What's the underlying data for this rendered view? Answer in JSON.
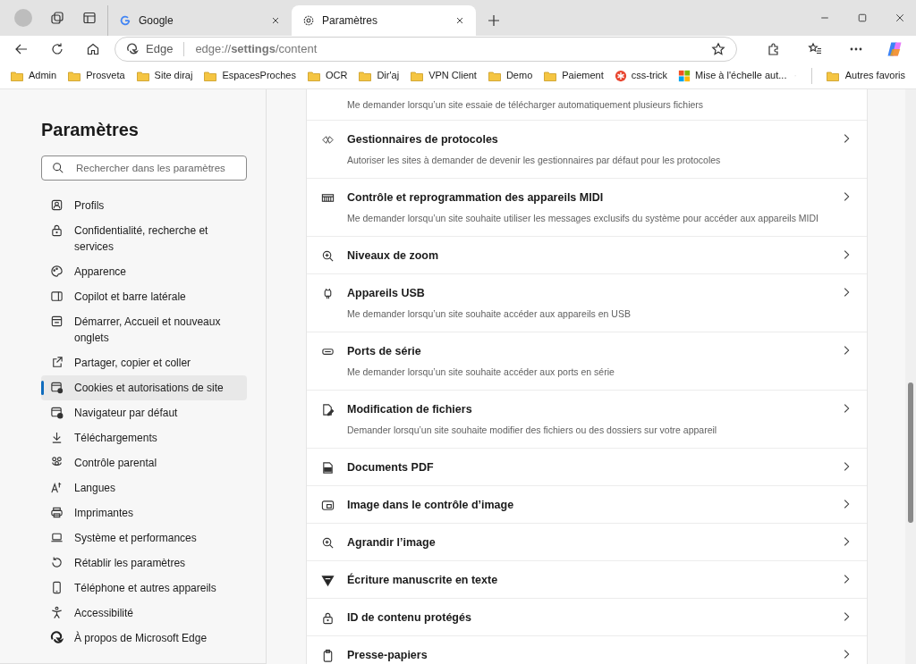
{
  "tabs": [
    {
      "label": "Google",
      "selected": false
    },
    {
      "label": "Paramètres",
      "selected": true
    }
  ],
  "address_bar": {
    "badge": "Edge",
    "url": "edge://**settings**/content"
  },
  "bookmarks": [
    {
      "label": "Admin",
      "kind": "folder"
    },
    {
      "label": "Prosveta",
      "kind": "folder"
    },
    {
      "label": "Site diraj",
      "kind": "folder"
    },
    {
      "label": "EspacesProches",
      "kind": "folder"
    },
    {
      "label": "OCR",
      "kind": "folder"
    },
    {
      "label": "Dir'aj",
      "kind": "folder"
    },
    {
      "label": "VPN Client",
      "kind": "folder"
    },
    {
      "label": "Demo",
      "kind": "folder"
    },
    {
      "label": "Paiement",
      "kind": "folder"
    },
    {
      "label": "css-trick",
      "kind": "star"
    },
    {
      "label": "Mise à l'échelle aut...",
      "kind": "tiles"
    }
  ],
  "other_bookmarks": "Autres favoris",
  "sidebar": {
    "title": "Paramètres",
    "search": {
      "placeholder": "Rechercher dans les paramètres"
    },
    "items": [
      {
        "label": "Profils",
        "selected": false
      },
      {
        "label": "Confidentialité, recherche et services",
        "selected": false
      },
      {
        "label": "Apparence",
        "selected": false
      },
      {
        "label": "Copilot et barre latérale",
        "selected": false
      },
      {
        "label": "Démarrer, Accueil et nouveaux onglets",
        "selected": false
      },
      {
        "label": "Partager, copier et coller",
        "selected": false
      },
      {
        "label": "Cookies et autorisations de site",
        "selected": true
      },
      {
        "label": "Navigateur par défaut",
        "selected": false
      },
      {
        "label": "Téléchargements",
        "selected": false
      },
      {
        "label": "Contrôle parental",
        "selected": false
      },
      {
        "label": "Langues",
        "selected": false
      },
      {
        "label": "Imprimantes",
        "selected": false
      },
      {
        "label": "Système et performances",
        "selected": false
      },
      {
        "label": "Rétablir les paramètres",
        "selected": false
      },
      {
        "label": "Téléphone et autres appareils",
        "selected": false
      },
      {
        "label": "Accessibilité",
        "selected": false
      },
      {
        "label": "À propos de Microsoft Edge",
        "selected": false
      }
    ]
  },
  "permissions": [
    {
      "description": "Me demander lorsqu’un site essaie de télécharger automatiquement plusieurs fichiers"
    },
    {
      "title": "Gestionnaires de protocoles",
      "description": "Autoriser les sites à demander de devenir les gestionnaires par défaut pour les protocoles"
    },
    {
      "title": "Contrôle et reprogrammation des appareils MIDI",
      "description": "Me demander lorsqu’un site souhaite utiliser les messages exclusifs du système pour accéder aux appareils MIDI"
    },
    {
      "title": "Niveaux de zoom"
    },
    {
      "title": "Appareils USB",
      "description": "Me demander lorsqu’un site souhaite accéder aux appareils en USB"
    },
    {
      "title": "Ports de série",
      "description": "Me demander lorsqu’un site souhaite accéder aux ports en série"
    },
    {
      "title": "Modification de fichiers",
      "description": "Demander lorsqu’un site souhaite modifier des fichiers ou des dossiers sur votre appareil"
    },
    {
      "title": "Documents PDF"
    },
    {
      "title": "Image dans le contrôle d’image"
    },
    {
      "title": "Agrandir l’image"
    },
    {
      "title": "Écriture manuscrite en texte"
    },
    {
      "title": "ID de contenu protégés"
    },
    {
      "title": "Presse-papiers"
    }
  ]
}
